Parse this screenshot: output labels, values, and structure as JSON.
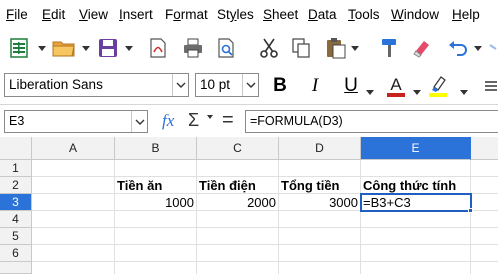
{
  "menubar": {
    "items": [
      {
        "label": "File",
        "ul": "F"
      },
      {
        "label": "Edit",
        "ul": "E"
      },
      {
        "label": "View",
        "ul": "V"
      },
      {
        "label": "Insert",
        "ul": "I"
      },
      {
        "label": "Format",
        "ul": "o"
      },
      {
        "label": "Styles",
        "ul": "y"
      },
      {
        "label": "Sheet",
        "ul": "S"
      },
      {
        "label": "Data",
        "ul": "D"
      },
      {
        "label": "Tools",
        "ul": "T"
      },
      {
        "label": "Window",
        "ul": "W"
      },
      {
        "label": "Help",
        "ul": "H"
      }
    ]
  },
  "toolbar": {
    "icons": [
      "new-spreadsheet-icon",
      "open-folder-icon",
      "save-icon",
      "export-pdf-icon",
      "print-icon",
      "print-preview-icon",
      "cut-icon",
      "copy-icon",
      "paste-icon",
      "clone-formatting-icon",
      "clear-formatting-icon",
      "undo-icon"
    ]
  },
  "format": {
    "font_name": "Liberation Sans",
    "font_size": "10 pt",
    "bold_label": "B",
    "italic_label": "I",
    "underline_label": "U",
    "font_color": "#c9211e",
    "highlight_color": "#ffff00"
  },
  "formula_bar": {
    "cell_ref": "E3",
    "fx": "fx",
    "sigma": "Σ",
    "equals": "=",
    "content": "=FORMULA(D3)"
  },
  "sheet": {
    "columns": [
      "A",
      "B",
      "C",
      "D",
      "E"
    ],
    "rows": [
      "1",
      "2",
      "3",
      "4",
      "5",
      "6"
    ],
    "headers_row2": {
      "B": "Tiền ăn",
      "C": "Tiền điện",
      "D": "Tổng tiền",
      "E": "Công thức tính"
    },
    "values_row3": {
      "B": "1000",
      "C": "2000",
      "D": "3000",
      "E": "=B3+C3"
    },
    "selected_cell": "E3",
    "selection_color": "#2b73d8"
  }
}
